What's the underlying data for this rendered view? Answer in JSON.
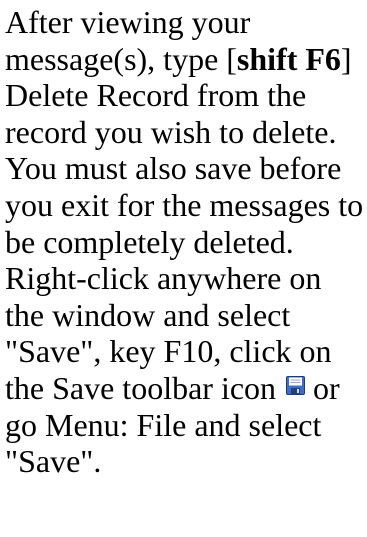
{
  "instructions": {
    "text_1": "After viewing your message(s), type [",
    "shortcut_delete": "shift F6",
    "text_2": "] Delete Record from the record you wish to delete. You must also save before you exit for the messages to be completely deleted. Right-click anywhere on the window and select \"Save\", key F10, click on the Save toolbar icon ",
    "text_3": " or go Menu: File and select \"Save\".",
    "inline_icon": "floppy-disk-save-icon",
    "icon_colors": {
      "body": "#3f6fc4",
      "label": "#ffffff",
      "shutter": "#1f3f80",
      "outline": "#1c3a7a"
    }
  }
}
